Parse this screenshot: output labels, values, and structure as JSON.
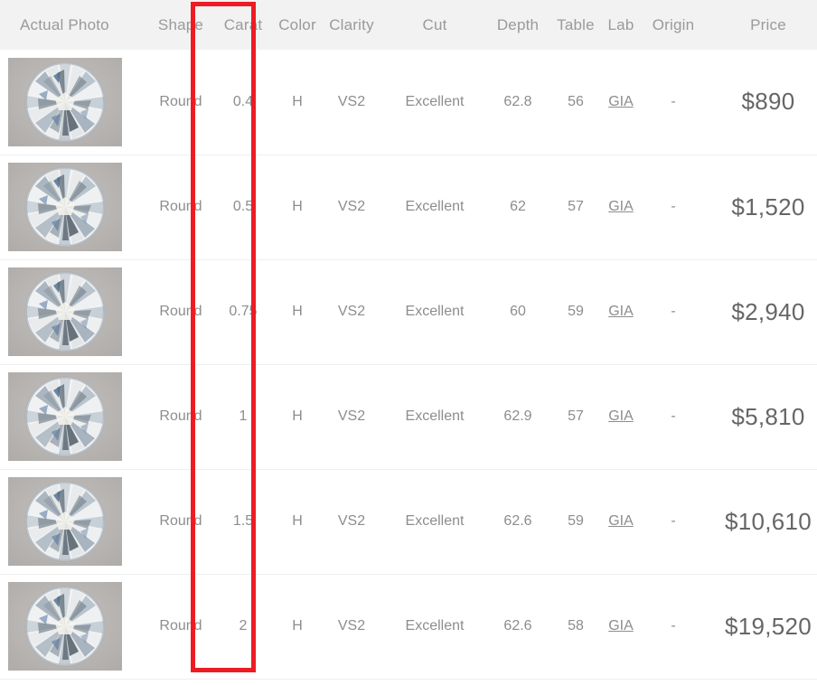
{
  "table": {
    "columns": [
      {
        "key": "photo",
        "label": "Actual Photo"
      },
      {
        "key": "shape",
        "label": "Shape"
      },
      {
        "key": "carat",
        "label": "Carat"
      },
      {
        "key": "color",
        "label": "Color"
      },
      {
        "key": "clarity",
        "label": "Clarity"
      },
      {
        "key": "cut",
        "label": "Cut"
      },
      {
        "key": "depth",
        "label": "Depth"
      },
      {
        "key": "table",
        "label": "Table"
      },
      {
        "key": "lab",
        "label": "Lab"
      },
      {
        "key": "origin",
        "label": "Origin"
      },
      {
        "key": "price",
        "label": "Price"
      }
    ],
    "rows": [
      {
        "photo_alt": "round-brilliant-diamond-photo",
        "shape": "Round",
        "carat": "0.4",
        "color": "H",
        "clarity": "VS2",
        "cut": "Excellent",
        "depth": "62.8",
        "table": "56",
        "lab": "GIA",
        "origin": "-",
        "price": "$890"
      },
      {
        "photo_alt": "round-brilliant-diamond-photo",
        "shape": "Round",
        "carat": "0.5",
        "color": "H",
        "clarity": "VS2",
        "cut": "Excellent",
        "depth": "62",
        "table": "57",
        "lab": "GIA",
        "origin": "-",
        "price": "$1,520"
      },
      {
        "photo_alt": "round-brilliant-diamond-photo",
        "shape": "Round",
        "carat": "0.75",
        "color": "H",
        "clarity": "VS2",
        "cut": "Excellent",
        "depth": "60",
        "table": "59",
        "lab": "GIA",
        "origin": "-",
        "price": "$2,940"
      },
      {
        "photo_alt": "round-brilliant-diamond-photo",
        "shape": "Round",
        "carat": "1",
        "color": "H",
        "clarity": "VS2",
        "cut": "Excellent",
        "depth": "62.9",
        "table": "57",
        "lab": "GIA",
        "origin": "-",
        "price": "$5,810"
      },
      {
        "photo_alt": "round-brilliant-diamond-photo",
        "shape": "Round",
        "carat": "1.5",
        "color": "H",
        "clarity": "VS2",
        "cut": "Excellent",
        "depth": "62.6",
        "table": "59",
        "lab": "GIA",
        "origin": "-",
        "price": "$10,610"
      },
      {
        "photo_alt": "round-brilliant-diamond-photo",
        "shape": "Round",
        "carat": "2",
        "color": "H",
        "clarity": "VS2",
        "cut": "Excellent",
        "depth": "62.6",
        "table": "58",
        "lab": "GIA",
        "origin": "-",
        "price": "$19,520"
      }
    ]
  },
  "annotation": {
    "target_column": "Carat",
    "color": "#ed1c24"
  },
  "colors": {
    "header_background": "#f2f2f2",
    "header_text": "#9a9a9a",
    "body_text": "#8d8d8d",
    "price_text": "#666666",
    "row_divider": "#eeeeee",
    "photo_background": "#b9b6b3"
  }
}
